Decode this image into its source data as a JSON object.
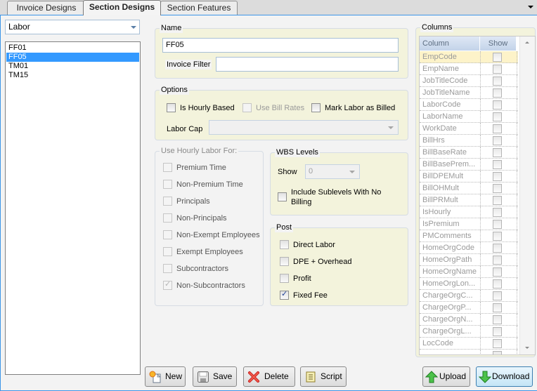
{
  "tabs": [
    {
      "label": "Invoice Designs",
      "active": false
    },
    {
      "label": "Section Designs",
      "active": true
    },
    {
      "label": "Section Features",
      "active": false
    }
  ],
  "left": {
    "section_type": "Labor",
    "designs": [
      "FF01",
      "FF05",
      "TM01",
      "TM15"
    ],
    "selected_design": "FF05"
  },
  "name_group": {
    "legend": "Name",
    "name_value": "FF05",
    "invoice_filter_label": "Invoice Filter",
    "invoice_filter_value": ""
  },
  "options_group": {
    "legend": "Options",
    "is_hourly_based": {
      "label": "Is Hourly Based",
      "checked": false,
      "enabled": true
    },
    "use_bill_rates": {
      "label": "Use Bill Rates",
      "checked": false,
      "enabled": false
    },
    "mark_labor_as_billed": {
      "label": "Mark Labor as Billed",
      "checked": false,
      "enabled": true
    },
    "labor_cap_label": "Labor Cap",
    "labor_cap_value": ""
  },
  "hourly_group": {
    "legend": "Use Hourly Labor For:",
    "items": [
      {
        "label": "Premium Time",
        "checked": false
      },
      {
        "label": "Non-Premium Time",
        "checked": false
      },
      {
        "label": "Principals",
        "checked": false
      },
      {
        "label": "Non-Principals",
        "checked": false
      },
      {
        "label": "Non-Exempt Employees",
        "checked": false
      },
      {
        "label": "Exempt Employees",
        "checked": false
      },
      {
        "label": "Subcontractors",
        "checked": false
      },
      {
        "label": "Non-Subcontractors",
        "checked": true
      }
    ]
  },
  "wbs_group": {
    "legend": "WBS Levels",
    "show_label": "Show",
    "show_value": "0",
    "include_sublevels_label_1": "Include Sublevels With No",
    "include_sublevels_label_2": "Billing",
    "include_sublevels_checked": false
  },
  "post_group": {
    "legend": "Post",
    "items": [
      {
        "label": "Direct Labor",
        "checked": false
      },
      {
        "label": "DPE + Overhead",
        "checked": false
      },
      {
        "label": "Profit",
        "checked": false
      },
      {
        "label": "Fixed Fee",
        "checked": true
      }
    ]
  },
  "columns_group": {
    "legend": "Columns",
    "header_column": "Column",
    "header_show": "Show",
    "rows": [
      {
        "name": "EmpCode",
        "show": false
      },
      {
        "name": "EmpName",
        "show": false
      },
      {
        "name": "JobTitleCode",
        "show": false
      },
      {
        "name": "JobTitleName",
        "show": false
      },
      {
        "name": "LaborCode",
        "show": false
      },
      {
        "name": "LaborName",
        "show": false
      },
      {
        "name": "WorkDate",
        "show": false
      },
      {
        "name": "BillHrs",
        "show": false
      },
      {
        "name": "BillBaseRate",
        "show": false
      },
      {
        "name": "BillBasePrem...",
        "show": false
      },
      {
        "name": "BillDPEMult",
        "show": false
      },
      {
        "name": "BillOHMult",
        "show": false
      },
      {
        "name": "BillPRMult",
        "show": false
      },
      {
        "name": "IsHourly",
        "show": false
      },
      {
        "name": "IsPremium",
        "show": false
      },
      {
        "name": "PMComments",
        "show": false
      },
      {
        "name": "HomeOrgCode",
        "show": false
      },
      {
        "name": "HomeOrgPath",
        "show": false
      },
      {
        "name": "HomeOrgName",
        "show": false
      },
      {
        "name": "HomeOrgLon...",
        "show": false
      },
      {
        "name": "ChargeOrgC...",
        "show": false
      },
      {
        "name": "ChargeOrgP...",
        "show": false
      },
      {
        "name": "ChargeOrgN...",
        "show": false
      },
      {
        "name": "ChargeOrgL...",
        "show": false
      },
      {
        "name": "LocCode",
        "show": false
      },
      {
        "name": "",
        "show": false
      }
    ]
  },
  "buttons": {
    "new": "New",
    "save": "Save",
    "delete": "Delete",
    "script": "Script",
    "upload": "Upload",
    "download": "Download"
  }
}
